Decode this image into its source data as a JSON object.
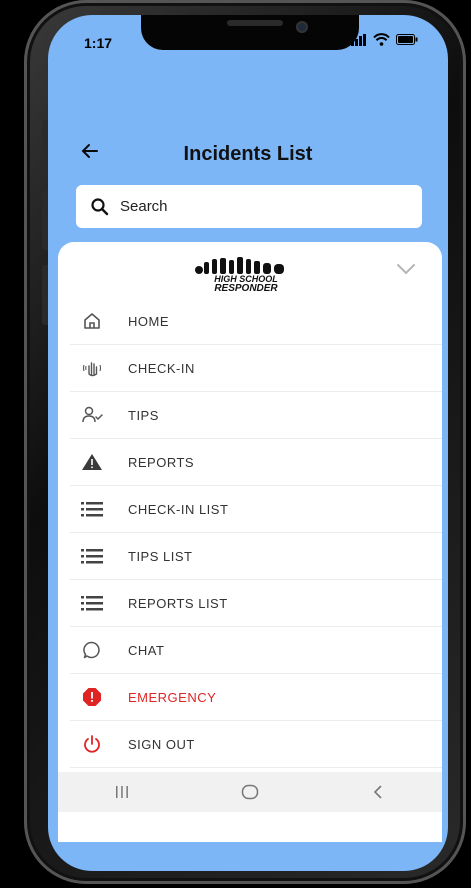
{
  "status": {
    "time": "1:17"
  },
  "header": {
    "title": "Incidents List"
  },
  "search": {
    "placeholder": "Search"
  },
  "colors": {
    "background": "#7db6f7",
    "danger": "#e02424"
  },
  "logo": {
    "line1": "HIGH SCHOOL",
    "line2": "RESPONDER"
  },
  "menu": {
    "items": [
      {
        "label": "HOME",
        "icon": "home-icon"
      },
      {
        "label": "CHECK-IN",
        "icon": "wave-hand-icon"
      },
      {
        "label": "TIPS",
        "icon": "user-check-icon"
      },
      {
        "label": "REPORTS",
        "icon": "warning-icon"
      },
      {
        "label": "CHECK-IN LIST",
        "icon": "list-icon"
      },
      {
        "label": "TIPS LIST",
        "icon": "list-icon"
      },
      {
        "label": "REPORTS LIST",
        "icon": "list-icon"
      },
      {
        "label": "CHAT",
        "icon": "chat-bubble-icon"
      },
      {
        "label": "EMERGENCY",
        "icon": "emergency-octagon-icon"
      },
      {
        "label": "SIGN OUT",
        "icon": "power-icon"
      }
    ]
  },
  "navbar": {
    "icons": [
      "recent-apps-icon",
      "home-circle-icon",
      "back-chevron-icon"
    ]
  }
}
